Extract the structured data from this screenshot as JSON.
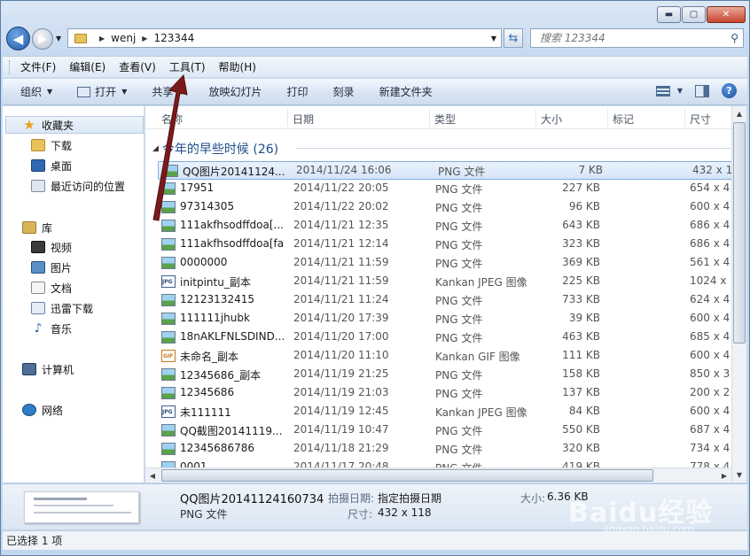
{
  "window": {
    "minimize": "▬",
    "maximize": "▢",
    "close": "✕"
  },
  "address": {
    "crumbs": [
      "wenj",
      "123344"
    ],
    "search_placeholder": "搜索 123344"
  },
  "menu": [
    "文件(F)",
    "编辑(E)",
    "查看(V)",
    "工具(T)",
    "帮助(H)"
  ],
  "commands": {
    "organize": "组织",
    "open": "打开",
    "share": "共享",
    "slideshow": "放映幻灯片",
    "print": "打印",
    "burn": "刻录",
    "new_folder": "新建文件夹"
  },
  "nav": {
    "favorites": "收藏夹",
    "downloads": "下载",
    "desktop": "桌面",
    "recent": "最近访问的位置",
    "libraries": "库",
    "videos": "视频",
    "pictures": "图片",
    "documents": "文档",
    "thunder": "迅雷下载",
    "music": "音乐",
    "computer": "计算机",
    "network": "网络"
  },
  "columns": {
    "name": "名称",
    "date": "日期",
    "type": "类型",
    "size": "大小",
    "tags": "标记",
    "dims": "尺寸"
  },
  "group_label": "今年的早些时候 (26)",
  "files": [
    {
      "name": "QQ图片20141124...",
      "date": "2014/11/24 16:06",
      "type": "PNG 文件",
      "size": "7 KB",
      "dims": "432 x 1",
      "icon": "png"
    },
    {
      "name": "17951",
      "date": "2014/11/22 20:05",
      "type": "PNG 文件",
      "size": "227 KB",
      "dims": "654 x 4",
      "icon": "png"
    },
    {
      "name": "97314305",
      "date": "2014/11/22 20:02",
      "type": "PNG 文件",
      "size": "96 KB",
      "dims": "600 x 4",
      "icon": "png"
    },
    {
      "name": "111akfhsodffdoa[...",
      "date": "2014/11/21 12:35",
      "type": "PNG 文件",
      "size": "643 KB",
      "dims": "686 x 4",
      "icon": "png"
    },
    {
      "name": "111akfhsodffdoa[fa",
      "date": "2014/11/21 12:14",
      "type": "PNG 文件",
      "size": "323 KB",
      "dims": "686 x 4",
      "icon": "png"
    },
    {
      "name": "0000000",
      "date": "2014/11/21 11:59",
      "type": "PNG 文件",
      "size": "369 KB",
      "dims": "561 x 4",
      "icon": "png"
    },
    {
      "name": "initpintu_副本",
      "date": "2014/11/21 11:59",
      "type": "Kankan JPEG 图像",
      "size": "225 KB",
      "dims": "1024 x",
      "icon": "jpg"
    },
    {
      "name": "12123132415",
      "date": "2014/11/21 11:24",
      "type": "PNG 文件",
      "size": "733 KB",
      "dims": "624 x 4",
      "icon": "png"
    },
    {
      "name": "111111jhubk",
      "date": "2014/11/20 17:39",
      "type": "PNG 文件",
      "size": "39 KB",
      "dims": "600 x 4",
      "icon": "png"
    },
    {
      "name": "18nAKLFNLSDIND...",
      "date": "2014/11/20 17:00",
      "type": "PNG 文件",
      "size": "463 KB",
      "dims": "685 x 4",
      "icon": "png"
    },
    {
      "name": "未命名_副本",
      "date": "2014/11/20 11:10",
      "type": "Kankan GIF 图像",
      "size": "111 KB",
      "dims": "600 x 4",
      "icon": "gif"
    },
    {
      "name": "12345686_副本",
      "date": "2014/11/19 21:25",
      "type": "PNG 文件",
      "size": "158 KB",
      "dims": "850 x 3",
      "icon": "png"
    },
    {
      "name": "12345686",
      "date": "2014/11/19 21:03",
      "type": "PNG 文件",
      "size": "137 KB",
      "dims": "200 x 2",
      "icon": "png"
    },
    {
      "name": "未111111",
      "date": "2014/11/19 12:45",
      "type": "Kankan JPEG 图像",
      "size": "84 KB",
      "dims": "600 x 4",
      "icon": "jpg"
    },
    {
      "name": "QQ截图20141119...",
      "date": "2014/11/19 10:47",
      "type": "PNG 文件",
      "size": "550 KB",
      "dims": "687 x 4",
      "icon": "png"
    },
    {
      "name": "12345686786",
      "date": "2014/11/18 21:29",
      "type": "PNG 文件",
      "size": "320 KB",
      "dims": "734 x 4",
      "icon": "png"
    },
    {
      "name": "0001",
      "date": "2014/11/17 20:48",
      "type": "PNG 文件",
      "size": "419 KB",
      "dims": "778 x 4",
      "icon": "png"
    }
  ],
  "details": {
    "title": "QQ图片20141124160734",
    "type": "PNG 文件",
    "date_label": "拍摄日期:",
    "date_value": "指定拍摄日期",
    "size_label": "大小:",
    "size_value": "6.36 KB",
    "dims_label": "尺寸:",
    "dims_value": "432 x 118"
  },
  "status": "已选择 1 项",
  "watermark": {
    "brand": "Baidu经验",
    "url": "jingyan.baidu.com"
  },
  "colors": {
    "selection": "#d4e5f9",
    "group": "#1f4e8c",
    "arrow": "#7a1a1a"
  }
}
